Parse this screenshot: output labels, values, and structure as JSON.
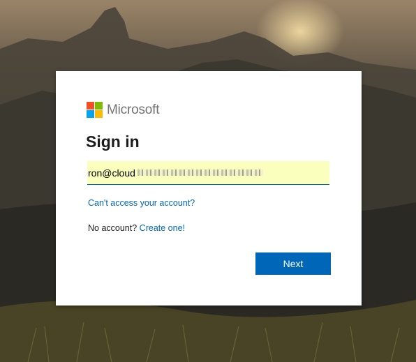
{
  "brand": {
    "name": "Microsoft"
  },
  "signin": {
    "title": "Sign in",
    "email_value": "ron@cloud",
    "cant_access_link": "Can't access your account?",
    "no_account_text": "No account?",
    "create_link": "Create one!",
    "next_label": "Next"
  },
  "colors": {
    "accent": "#0067b8",
    "autofill_bg": "#faffbd",
    "logo_red": "#f25022",
    "logo_green": "#7fba00",
    "logo_blue": "#00a4ef",
    "logo_yellow": "#ffb900"
  }
}
